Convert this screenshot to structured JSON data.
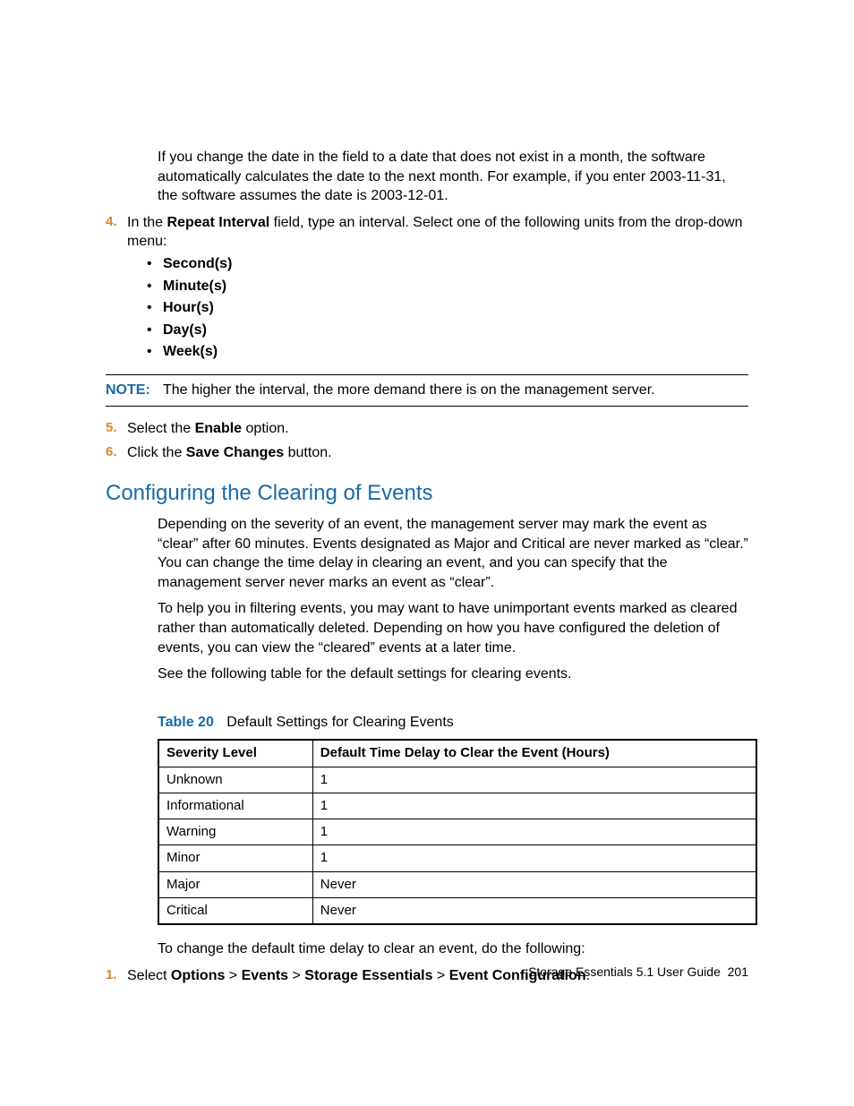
{
  "intro_para": "If you change the date in the field to a date that does not exist in a month, the software automatically calculates the date to the next month. For example, if you enter 2003-11-31, the software assumes the date is 2003-12-01.",
  "step4": {
    "num": "4.",
    "lead": "In the ",
    "bold1": "Repeat Interval",
    "tail": " field, type an interval. Select one of the following units from the drop-down menu:",
    "items": [
      "Second(s)",
      "Minute(s)",
      "Hour(s)",
      "Day(s)",
      "Week(s)"
    ]
  },
  "note": {
    "label": "NOTE:",
    "text": "The higher the interval, the more demand there is on the management server."
  },
  "step5": {
    "num": "5.",
    "lead": "Select the ",
    "bold": "Enable",
    "tail": " option."
  },
  "step6": {
    "num": "6.",
    "lead": "Click the ",
    "bold": "Save Changes",
    "tail": " button."
  },
  "heading": "Configuring the Clearing of Events",
  "p1": "Depending on the severity of an event, the management server may mark the event as “clear” after 60 minutes. Events designated as Major and Critical are never marked as “clear.” You can change the time delay in clearing an event, and you can specify that the management server never marks an event as “clear”.",
  "p2": "To help you in filtering events, you may want to have unimportant events marked as cleared rather than automatically deleted. Depending on how you have configured the deletion of events, you can view the “cleared” events at a later time.",
  "p3": "See the following table for the default settings for clearing events.",
  "table": {
    "caption_label": "Table 20",
    "caption_text": "Default Settings for Clearing Events",
    "headers": [
      "Severity Level",
      "Default Time Delay to Clear the Event (Hours)"
    ],
    "rows": [
      [
        "Unknown",
        "1"
      ],
      [
        "Informational",
        "1"
      ],
      [
        "Warning",
        "1"
      ],
      [
        "Minor",
        "1"
      ],
      [
        "Major",
        "Never"
      ],
      [
        "Critical",
        "Never"
      ]
    ]
  },
  "p4": "To change the default time delay to clear an event, do the following:",
  "step1b": {
    "num": "1.",
    "lead": "Select ",
    "path": [
      "Options",
      "Events",
      "Storage Essentials",
      "Event Configuration"
    ],
    "sep": " > ",
    "tail": "."
  },
  "footer": {
    "title": "Storage Essentials 5.1 User Guide",
    "page": "201"
  }
}
